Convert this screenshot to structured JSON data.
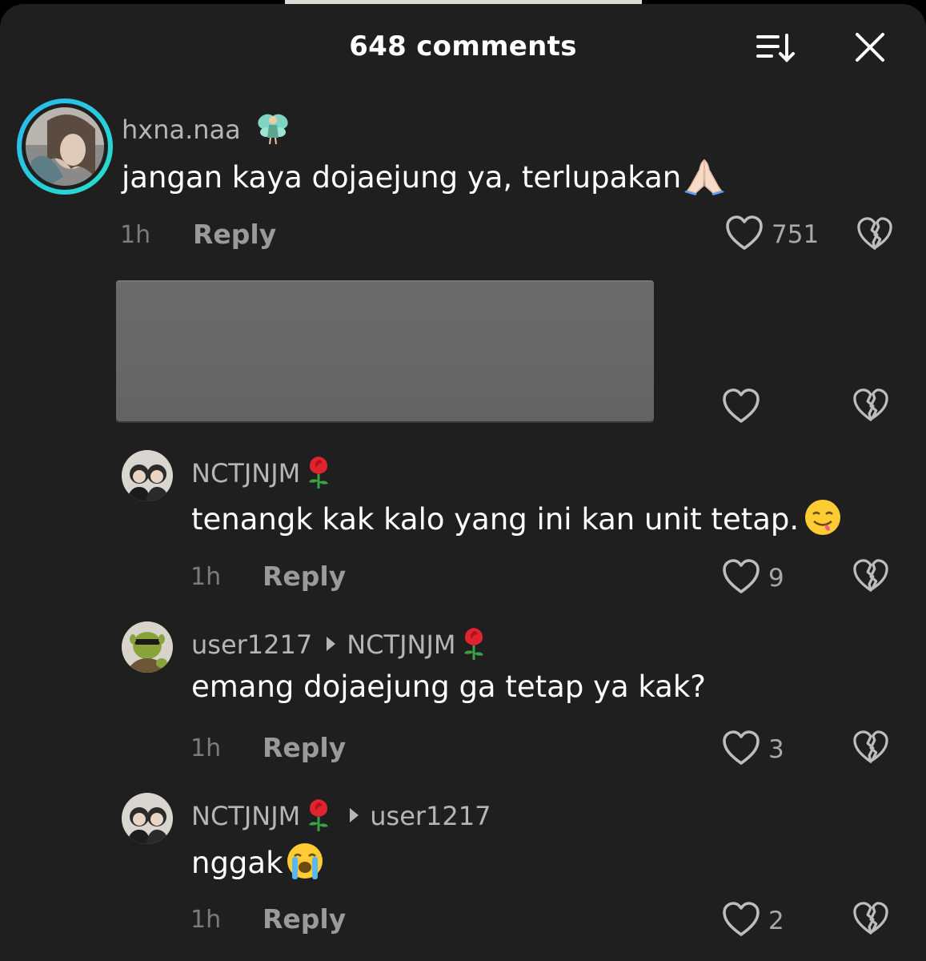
{
  "header": {
    "title": "648 comments"
  },
  "icons": {
    "sort": "sort-icon",
    "close": "close-icon",
    "like": "heart-icon",
    "dislike": "broken-heart-icon"
  },
  "colors": {
    "background": "#1f1f1f",
    "avatar_ring_start": "#2ab7f0",
    "avatar_ring_end": "#27e0c8"
  },
  "comments": [
    {
      "username": "hxna.naa",
      "username_emoji": "fairy",
      "text": "jangan kaya dojaejung ya, terlupakan",
      "text_emoji": "folded-hands",
      "time": "1h",
      "reply_label": "Reply",
      "likes": "751"
    },
    {
      "username": "NCTJNJM",
      "username_emoji": "rose",
      "text": "tenangk kak kalo yang ini kan unit tetap.",
      "text_emoji": "face-savoring-food",
      "time": "1h",
      "reply_label": "Reply",
      "likes": "9"
    },
    {
      "username": "user1217",
      "reply_to": "NCTJNJM",
      "reply_to_emoji": "rose",
      "text": "emang dojaejung ga tetap ya kak?",
      "time": "1h",
      "reply_label": "Reply",
      "likes": "3"
    },
    {
      "username": "NCTJNJM",
      "username_emoji": "rose",
      "reply_to": "user1217",
      "text": "nggak",
      "text_emoji": "loudly-crying-face",
      "time": "1h",
      "reply_label": "Reply",
      "likes": "2"
    }
  ]
}
